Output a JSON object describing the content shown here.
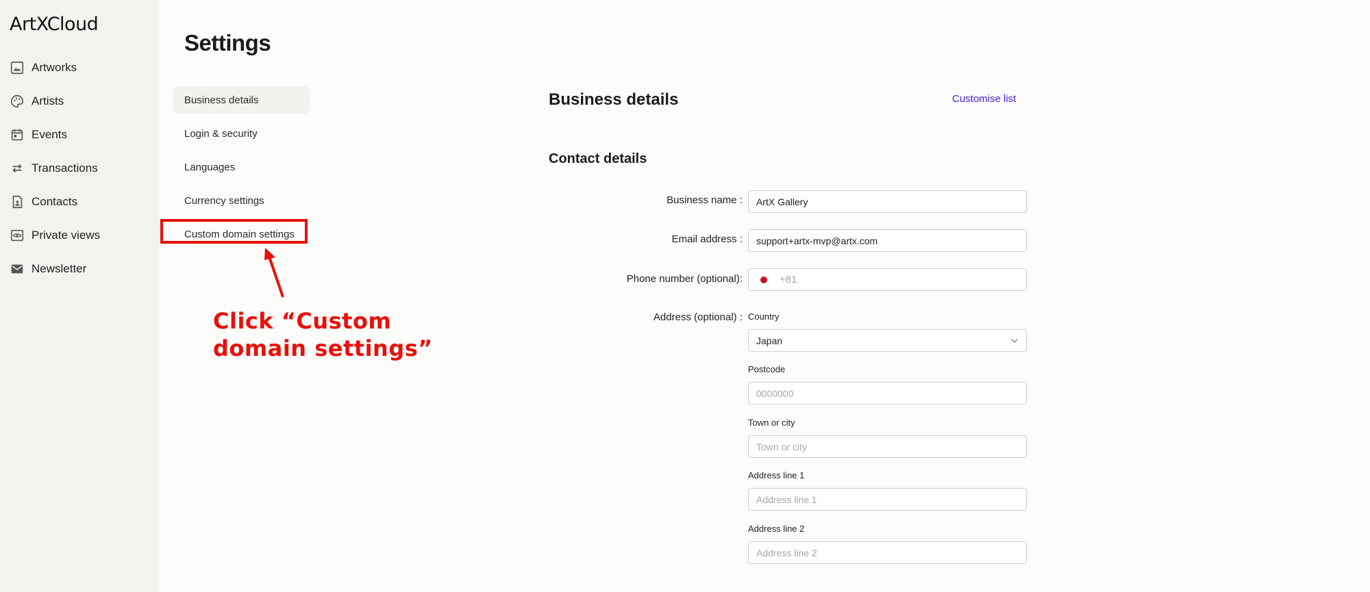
{
  "app": {
    "logo": "ArtXCloud"
  },
  "sidebar": {
    "items": [
      {
        "label": "Artworks",
        "icon": "image-icon"
      },
      {
        "label": "Artists",
        "icon": "palette-icon"
      },
      {
        "label": "Events",
        "icon": "calendar-icon"
      },
      {
        "label": "Transactions",
        "icon": "swap-arrows-icon"
      },
      {
        "label": "Contacts",
        "icon": "contact-card-icon"
      },
      {
        "label": "Private views",
        "icon": "eye-icon"
      },
      {
        "label": "Newsletter",
        "icon": "mail-icon"
      }
    ]
  },
  "page": {
    "title": "Settings"
  },
  "settings_menu": {
    "items": [
      {
        "label": "Business details",
        "active": true
      },
      {
        "label": "Login & security"
      },
      {
        "label": "Languages"
      },
      {
        "label": "Currency settings"
      },
      {
        "label": "Custom domain settings"
      }
    ]
  },
  "annotation": {
    "line1": "Click “Custom",
    "line2": "domain settings”",
    "color": "#e8100b"
  },
  "main": {
    "section_title": "Business details",
    "customise_link": "Customise list",
    "contact_title": "Contact details",
    "business_name": {
      "label": "Business name",
      "value": "ArtX Gallery"
    },
    "email": {
      "label": "Email address",
      "value": "support+artx-mvp@artx.com"
    },
    "phone": {
      "label": "Phone number (optional)",
      "value": "+81",
      "country_flag": "japan-flag-icon"
    },
    "address": {
      "label": "Address (optional)",
      "country_label": "Country",
      "country_value": "Japan",
      "postcode_label": "Postcode",
      "postcode_placeholder": "0000000",
      "town_label": "Town or city",
      "town_placeholder": "Town or city",
      "line1_label": "Address line 1",
      "line1_placeholder": "Address line 1",
      "line2_label": "Address line 2",
      "line2_placeholder": "Address line 2"
    }
  },
  "colors": {
    "accent": "#4b1fd1",
    "sidebar_bg": "#f2f2ee",
    "page_bg": "#fcfcfa"
  }
}
